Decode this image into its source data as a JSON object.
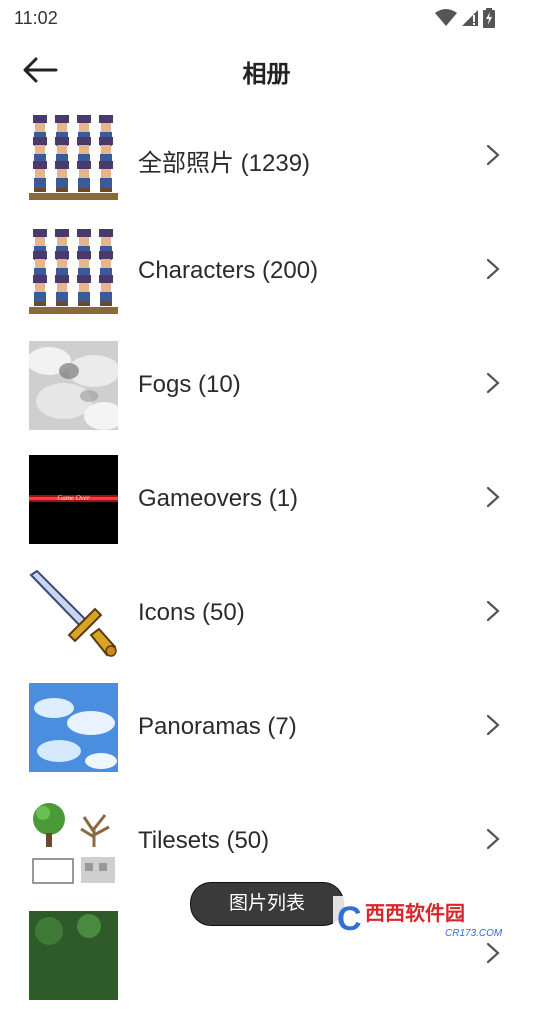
{
  "status_bar": {
    "time": "11:02",
    "icons": [
      "wifi-icon",
      "signal-icon",
      "battery-charging-icon"
    ]
  },
  "header": {
    "back_icon": "arrow-left-icon",
    "title": "相册"
  },
  "albums": [
    {
      "label": "全部照片 (1239)",
      "thumb": "characters-sprite-sheet"
    },
    {
      "label": "Characters (200)",
      "thumb": "characters-sprite-sheet"
    },
    {
      "label": "Fogs (10)",
      "thumb": "fog-texture"
    },
    {
      "label": "Gameovers (1)",
      "thumb": "game-over-screen"
    },
    {
      "label": "Icons (50)",
      "thumb": "sword-icon"
    },
    {
      "label": "Panoramas (7)",
      "thumb": "sky-clouds"
    },
    {
      "label": "Tilesets (50)",
      "thumb": "trees-tileset"
    },
    {
      "label": "",
      "thumb": "forest-tile"
    }
  ],
  "thumb_texts": {
    "game_over": "Game Over"
  },
  "toast": {
    "text": "图片列表"
  },
  "watermark": {
    "logo_letter": "C",
    "brand": "西西软件园",
    "domain": "CR173.COM"
  },
  "colors": {
    "accent_blue": "#2f6fd6",
    "toast_bg": "#3a3a3a",
    "chevron": "#555555",
    "watermark_red": "#d8262b"
  }
}
